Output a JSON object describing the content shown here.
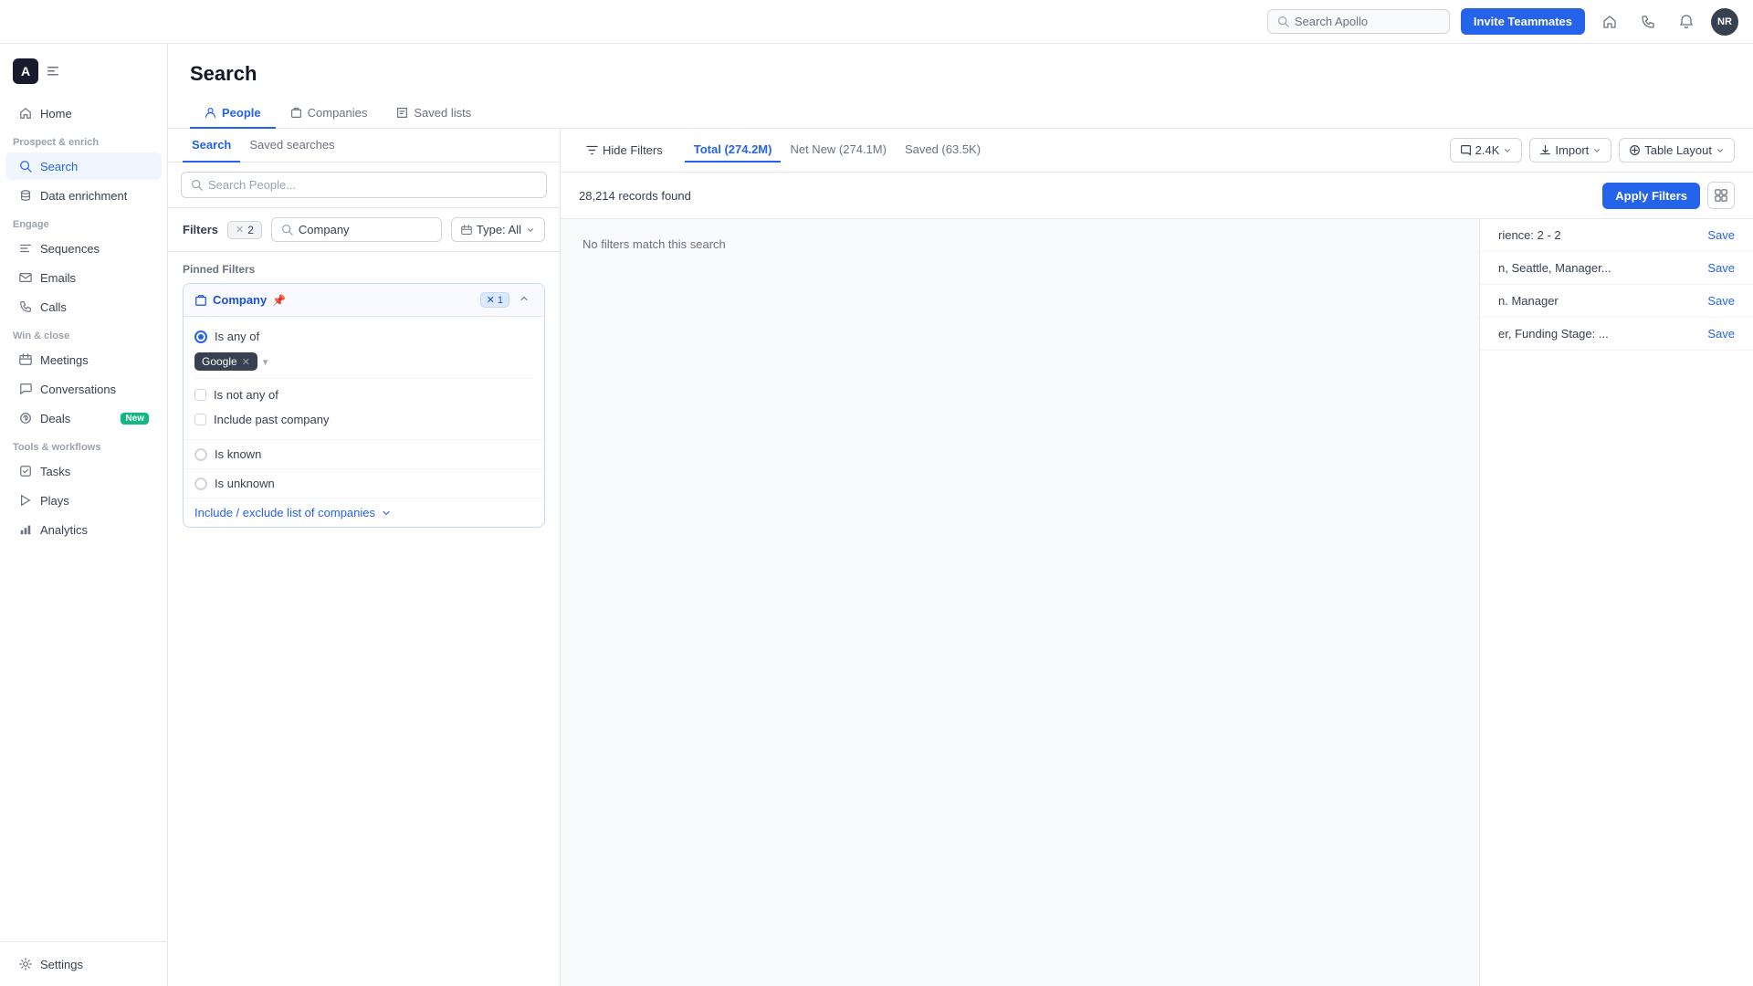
{
  "topnav": {
    "search_placeholder": "Search Apollo",
    "invite_btn": "Invite Teammates",
    "avatar_initials": "NR"
  },
  "sidebar": {
    "logo_text": "A",
    "sections": [
      {
        "label": null,
        "items": [
          {
            "id": "home",
            "label": "Home",
            "icon": "home-icon"
          }
        ]
      },
      {
        "label": "Prospect & enrich",
        "items": [
          {
            "id": "search",
            "label": "Search",
            "icon": "search-icon",
            "active": true
          },
          {
            "id": "data-enrichment",
            "label": "Data enrichment",
            "icon": "database-icon"
          }
        ]
      },
      {
        "label": "Engage",
        "items": [
          {
            "id": "sequences",
            "label": "Sequences",
            "icon": "sequences-icon"
          },
          {
            "id": "emails",
            "label": "Emails",
            "icon": "email-icon"
          },
          {
            "id": "calls",
            "label": "Calls",
            "icon": "calls-icon"
          }
        ]
      },
      {
        "label": "Win & close",
        "items": [
          {
            "id": "meetings",
            "label": "Meetings",
            "icon": "meetings-icon"
          },
          {
            "id": "conversations",
            "label": "Conversations",
            "icon": "conversations-icon"
          },
          {
            "id": "deals",
            "label": "Deals",
            "icon": "deals-icon",
            "badge": "New"
          }
        ]
      },
      {
        "label": "Tools & workflows",
        "items": [
          {
            "id": "tasks",
            "label": "Tasks",
            "icon": "tasks-icon"
          },
          {
            "id": "plays",
            "label": "Plays",
            "icon": "plays-icon"
          },
          {
            "id": "analytics",
            "label": "Analytics",
            "icon": "analytics-icon"
          }
        ]
      }
    ],
    "bottom_items": [
      {
        "id": "settings",
        "label": "Settings",
        "icon": "settings-icon"
      }
    ]
  },
  "main": {
    "page_title": "Search",
    "tabs": [
      {
        "id": "people",
        "label": "People",
        "active": true
      },
      {
        "id": "companies",
        "label": "Companies"
      },
      {
        "id": "saved-lists",
        "label": "Saved lists"
      }
    ]
  },
  "left_panel": {
    "tabs": [
      {
        "id": "search",
        "label": "Search",
        "active": true
      },
      {
        "id": "saved-searches",
        "label": "Saved searches"
      }
    ],
    "search_placeholder": "Search People...",
    "filters_label": "Filters",
    "filter_count": "2",
    "company_filter_value": "Company",
    "type_filter_label": "Type: All",
    "pinned_filters_label": "Pinned Filters",
    "filter_card": {
      "title": "Company",
      "pin_icon": "pin-icon",
      "count": "1",
      "option_is_any_of": "Is any of",
      "google_tag": "Google",
      "option_is_not_any_of": "Is not any of",
      "option_include_past": "Include past company",
      "option_is_known": "Is known",
      "option_is_unknown": "Is unknown",
      "include_exclude": "Include / exclude list of companies"
    }
  },
  "right_panel": {
    "hide_filters_btn": "Hide Filters",
    "tabs": [
      {
        "id": "total",
        "label": "Total (274.2M)",
        "active": true
      },
      {
        "id": "net-new",
        "label": "Net New (274.1M)"
      },
      {
        "id": "saved",
        "label": "Saved (63.5K)"
      }
    ],
    "count_btn_label": "2.4K",
    "import_btn": "Import",
    "table_layout_btn": "Table Layout",
    "records_count": "28,214 records found",
    "apply_filters_btn": "Apply Filters",
    "no_match_text": "No filters match this search",
    "saved_searches": [
      {
        "description": "rience: 2 - 2",
        "save_label": "Save"
      },
      {
        "description": "n, Seattle, Manager...",
        "save_label": "Save"
      },
      {
        "description": "n. Manager",
        "save_label": "Save"
      },
      {
        "description": "er, Funding Stage: ...",
        "save_label": "Save"
      }
    ]
  }
}
